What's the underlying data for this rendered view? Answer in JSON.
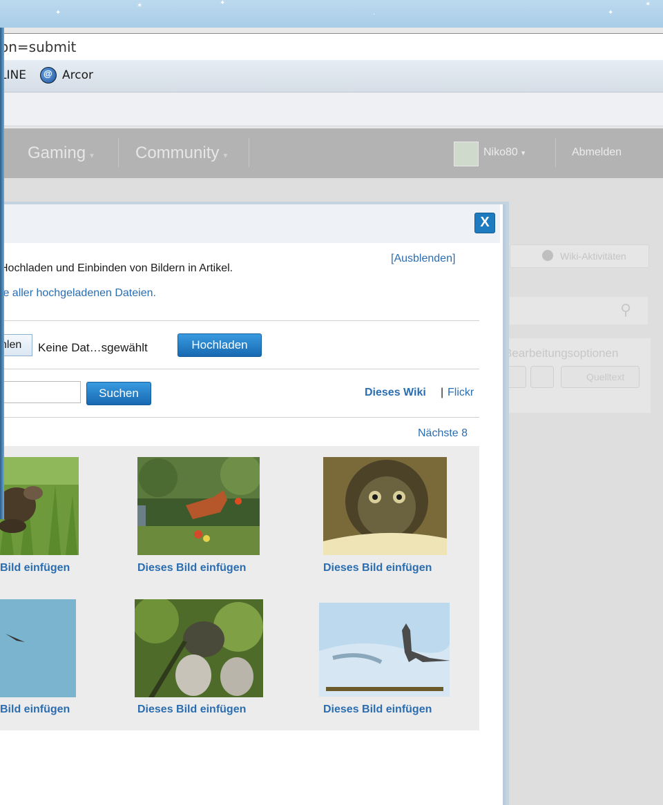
{
  "browser": {
    "address_text": "on=submit",
    "bookmarks": [
      {
        "label": "LINE",
        "icon": "none"
      },
      {
        "label": "Arcor",
        "icon": "arcor-icon"
      }
    ]
  },
  "wiki_nav": {
    "items": [
      {
        "label": "Gaming",
        "icon": "chevron-down-icon"
      },
      {
        "label": "Community",
        "icon": "chevron-down-icon"
      }
    ],
    "user": "Niko80",
    "logout": "Abmelden"
  },
  "right_panel": {
    "wiki_activity": "Wiki-Aktivitäten",
    "edit_options": "Bearbeitungsoptionen",
    "source": "Quelltext"
  },
  "dialog": {
    "close_label": "X",
    "hide_link": "[Ausblenden]",
    "intro_line1": "Hochladen und Einbinden von Bildern in Artikel.",
    "intro_line2_link": "te aller hochgeladenen Dateien.",
    "file_button": "hlen",
    "file_status": "Keine Dat…sgewählt",
    "upload_button": "Hochladen",
    "search_placeholder": "",
    "search_button": "Suchen",
    "source_this_wiki": "Dieses Wiki",
    "source_sep": "|",
    "source_flickr": "Flickr",
    "next_link": "Nächste 8",
    "images": [
      {
        "caption": "Bild einfügen"
      },
      {
        "caption": "Dieses Bild einfügen"
      },
      {
        "caption": "Dieses Bild einfügen"
      },
      {
        "caption": "Bild einfügen"
      },
      {
        "caption": "Dieses Bild einfügen"
      },
      {
        "caption": "Dieses Bild einfügen"
      }
    ]
  }
}
